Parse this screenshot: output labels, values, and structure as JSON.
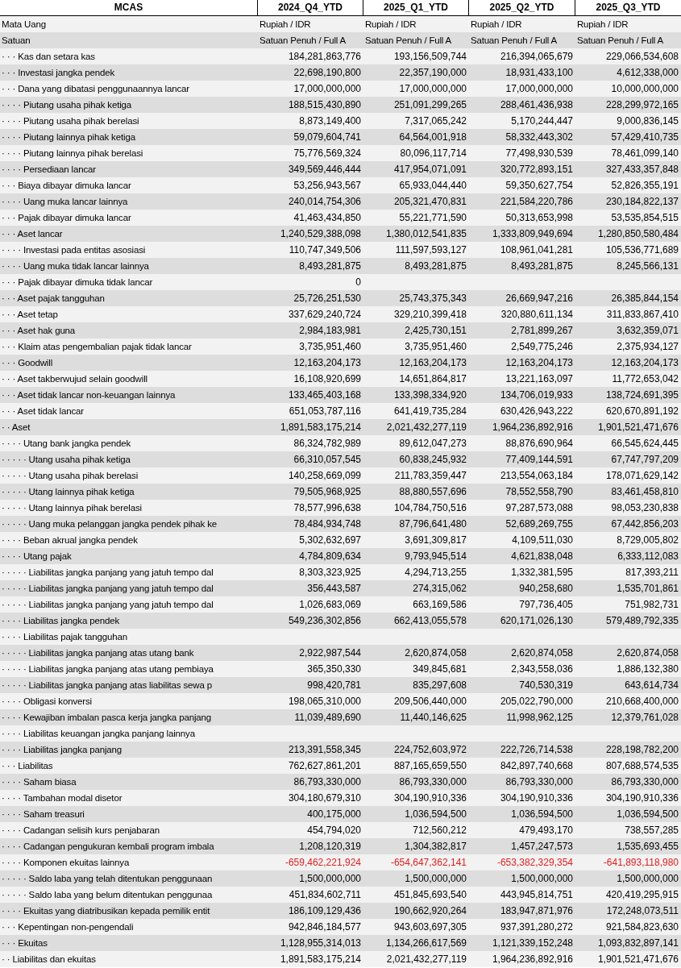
{
  "sheet": {
    "corner": "MCAS",
    "columns": [
      "2024_Q4_YTD",
      "2025_Q1_YTD",
      "2025_Q2_YTD",
      "2025_Q3_YTD"
    ],
    "rows": [
      {
        "label": "Mata Uang",
        "kind": "text",
        "negative": false,
        "values": [
          "Rupiah / IDR",
          "Rupiah / IDR",
          "Rupiah / IDR",
          "Rupiah / IDR"
        ]
      },
      {
        "label": "Satuan",
        "kind": "text",
        "negative": false,
        "values": [
          "Satuan Penuh / Full A",
          "Satuan Penuh / Full A",
          "Satuan Penuh / Full A",
          "Satuan Penuh / Full A"
        ]
      },
      {
        "label": "· · · Kas dan setara kas",
        "kind": "number",
        "negative": false,
        "values": [
          "184,281,863,776",
          "193,156,509,744",
          "216,394,065,679",
          "229,066,534,608"
        ]
      },
      {
        "label": "· · · Investasi jangka pendek",
        "kind": "number",
        "negative": false,
        "values": [
          "22,698,190,800",
          "22,357,190,000",
          "18,931,433,100",
          "4,612,338,000"
        ]
      },
      {
        "label": "· · · Dana yang dibatasi penggunaannya lancar",
        "kind": "number",
        "negative": false,
        "values": [
          "17,000,000,000",
          "17,000,000,000",
          "17,000,000,000",
          "10,000,000,000"
        ]
      },
      {
        "label": "· · · · Piutang usaha pihak ketiga",
        "kind": "number",
        "negative": false,
        "values": [
          "188,515,430,890",
          "251,091,299,265",
          "288,461,436,938",
          "228,299,972,165"
        ]
      },
      {
        "label": "· · · · Piutang usaha pihak berelasi",
        "kind": "number",
        "negative": false,
        "values": [
          "8,873,149,400",
          "7,317,065,242",
          "5,170,244,447",
          "9,000,836,145"
        ]
      },
      {
        "label": "· · · · Piutang lainnya pihak ketiga",
        "kind": "number",
        "negative": false,
        "values": [
          "59,079,604,741",
          "64,564,001,918",
          "58,332,443,302",
          "57,429,410,735"
        ]
      },
      {
        "label": "· · · · Piutang lainnya pihak berelasi",
        "kind": "number",
        "negative": false,
        "values": [
          "75,776,569,324",
          "80,096,117,714",
          "77,498,930,539",
          "78,461,099,140"
        ]
      },
      {
        "label": "· · · · Persediaan lancar",
        "kind": "number",
        "negative": false,
        "values": [
          "349,569,446,444",
          "417,954,071,091",
          "320,772,893,151",
          "327,433,357,848"
        ]
      },
      {
        "label": "· · · Biaya dibayar dimuka lancar",
        "kind": "number",
        "negative": false,
        "values": [
          "53,256,943,567",
          "65,933,044,440",
          "59,350,627,754",
          "52,826,355,191"
        ]
      },
      {
        "label": "· · · · Uang muka lancar lainnya",
        "kind": "number",
        "negative": false,
        "values": [
          "240,014,754,306",
          "205,321,470,831",
          "221,584,220,786",
          "230,184,822,137"
        ]
      },
      {
        "label": "· · · Pajak dibayar dimuka lancar",
        "kind": "number",
        "negative": false,
        "values": [
          "41,463,434,850",
          "55,221,771,590",
          "50,313,653,998",
          "53,535,854,515"
        ]
      },
      {
        "label": "· · · Aset lancar",
        "kind": "number",
        "negative": false,
        "values": [
          "1,240,529,388,098",
          "1,380,012,541,835",
          "1,333,809,949,694",
          "1,280,850,580,484"
        ]
      },
      {
        "label": "· · · · Investasi pada entitas asosiasi",
        "kind": "number",
        "negative": false,
        "values": [
          "110,747,349,506",
          "111,597,593,127",
          "108,961,041,281",
          "105,536,771,689"
        ]
      },
      {
        "label": "· · · · Uang muka tidak lancar lainnya",
        "kind": "number",
        "negative": false,
        "values": [
          "8,493,281,875",
          "8,493,281,875",
          "8,493,281,875",
          "8,245,566,131"
        ]
      },
      {
        "label": "· · · Pajak dibayar dimuka tidak lancar",
        "kind": "number",
        "negative": false,
        "values": [
          "0"
        ]
      },
      {
        "label": "· · · Aset pajak tangguhan",
        "kind": "number",
        "negative": false,
        "values": [
          "25,726,251,530",
          "25,743,375,343",
          "26,669,947,216",
          "26,385,844,154"
        ]
      },
      {
        "label": "· · · Aset tetap",
        "kind": "number",
        "negative": false,
        "values": [
          "337,629,240,724",
          "329,210,399,418",
          "320,880,611,134",
          "311,833,867,410"
        ]
      },
      {
        "label": "· · · Aset hak guna",
        "kind": "number",
        "negative": false,
        "values": [
          "2,984,183,981",
          "2,425,730,151",
          "2,781,899,267",
          "3,632,359,071"
        ]
      },
      {
        "label": "· · · Klaim atas pengembalian pajak tidak lancar",
        "kind": "number",
        "negative": false,
        "values": [
          "3,735,951,460",
          "3,735,951,460",
          "2,549,775,246",
          "2,375,934,127"
        ]
      },
      {
        "label": "· · · Goodwill",
        "kind": "number",
        "negative": false,
        "values": [
          "12,163,204,173",
          "12,163,204,173",
          "12,163,204,173",
          "12,163,204,173"
        ]
      },
      {
        "label": "· · · Aset takberwujud selain goodwill",
        "kind": "number",
        "negative": false,
        "values": [
          "16,108,920,699",
          "14,651,864,817",
          "13,221,163,097",
          "11,772,653,042"
        ]
      },
      {
        "label": "· · · Aset tidak lancar non-keuangan lainnya",
        "kind": "number",
        "negative": false,
        "values": [
          "133,465,403,168",
          "133,398,334,920",
          "134,706,019,933",
          "138,724,691,395"
        ]
      },
      {
        "label": "· · · Aset tidak lancar",
        "kind": "number",
        "negative": false,
        "values": [
          "651,053,787,116",
          "641,419,735,284",
          "630,426,943,222",
          "620,670,891,192"
        ]
      },
      {
        "label": "· · Aset",
        "kind": "number",
        "negative": false,
        "values": [
          "1,891,583,175,214",
          "2,021,432,277,119",
          "1,964,236,892,916",
          "1,901,521,471,676"
        ]
      },
      {
        "label": "· · · · Utang bank jangka pendek",
        "kind": "number",
        "negative": false,
        "values": [
          "86,324,782,989",
          "89,612,047,273",
          "88,876,690,964",
          "66,545,624,445"
        ]
      },
      {
        "label": "· · · · · Utang usaha pihak ketiga",
        "kind": "number",
        "negative": false,
        "values": [
          "66,310,057,545",
          "60,838,245,932",
          "77,409,144,591",
          "67,747,797,209"
        ]
      },
      {
        "label": "· · · · · Utang usaha pihak berelasi",
        "kind": "number",
        "negative": false,
        "values": [
          "140,258,669,099",
          "211,783,359,447",
          "213,554,063,184",
          "178,071,629,142"
        ]
      },
      {
        "label": "· · · · · Utang lainnya pihak ketiga",
        "kind": "number",
        "negative": false,
        "values": [
          "79,505,968,925",
          "88,880,557,696",
          "78,552,558,790",
          "83,461,458,810"
        ]
      },
      {
        "label": "· · · · · Utang lainnya pihak berelasi",
        "kind": "number",
        "negative": false,
        "values": [
          "78,577,996,638",
          "104,784,750,516",
          "97,287,573,088",
          "98,053,230,838"
        ]
      },
      {
        "label": "· · · · · Uang muka pelanggan jangka pendek pihak ke",
        "kind": "number",
        "negative": false,
        "values": [
          "78,484,934,748",
          "87,796,641,480",
          "52,689,269,755",
          "67,442,856,203"
        ]
      },
      {
        "label": "· · · · Beban akrual jangka pendek",
        "kind": "number",
        "negative": false,
        "values": [
          "5,302,632,697",
          "3,691,309,817",
          "4,109,511,030",
          "8,729,005,802"
        ]
      },
      {
        "label": "· · · · Utang pajak",
        "kind": "number",
        "negative": false,
        "values": [
          "4,784,809,634",
          "9,793,945,514",
          "4,621,838,048",
          "6,333,112,083"
        ]
      },
      {
        "label": "· · · · · Liabilitas jangka panjang yang jatuh tempo dal",
        "kind": "number",
        "negative": false,
        "values": [
          "8,303,323,925",
          "4,294,713,255",
          "1,332,381,595",
          "817,393,211"
        ]
      },
      {
        "label": "· · · · · Liabilitas jangka panjang yang jatuh tempo dal",
        "kind": "number",
        "negative": false,
        "values": [
          "356,443,587",
          "274,315,062",
          "940,258,680",
          "1,535,701,861"
        ]
      },
      {
        "label": "· · · · · Liabilitas jangka panjang yang jatuh tempo dal",
        "kind": "number",
        "negative": false,
        "values": [
          "1,026,683,069",
          "663,169,586",
          "797,736,405",
          "751,982,731"
        ]
      },
      {
        "label": "· · · · Liabilitas jangka pendek",
        "kind": "number",
        "negative": false,
        "values": [
          "549,236,302,856",
          "662,413,055,578",
          "620,171,026,130",
          "579,489,792,335"
        ]
      },
      {
        "label": "· · · · Liabilitas pajak tangguhan",
        "kind": "number"
      },
      {
        "label": "· · · · · Liabilitas jangka panjang atas utang bank",
        "kind": "number",
        "negative": false,
        "values": [
          "2,922,987,544",
          "2,620,874,058",
          "2,620,874,058",
          "2,620,874,058"
        ]
      },
      {
        "label": "· · · · · Liabilitas jangka panjang atas utang pembiaya",
        "kind": "number",
        "negative": false,
        "values": [
          "365,350,330",
          "349,845,681",
          "2,343,558,036",
          "1,886,132,380"
        ]
      },
      {
        "label": "· · · · · Liabilitas jangka panjang atas liabilitas sewa p",
        "kind": "number",
        "negative": false,
        "values": [
          "998,420,781",
          "835,297,608",
          "740,530,319",
          "643,614,734"
        ]
      },
      {
        "label": "· · · · Obligasi konversi",
        "kind": "number",
        "negative": false,
        "values": [
          "198,065,310,000",
          "209,506,440,000",
          "205,022,790,000",
          "210,668,400,000"
        ]
      },
      {
        "label": "· · · · Kewajiban imbalan pasca kerja jangka panjang",
        "kind": "number",
        "negative": false,
        "values": [
          "11,039,489,690",
          "11,440,146,625",
          "11,998,962,125",
          "12,379,761,028"
        ]
      },
      {
        "label": "· · · · Liabilitas keuangan jangka panjang lainnya",
        "kind": "number"
      },
      {
        "label": "· · · · Liabilitas jangka panjang",
        "kind": "number",
        "negative": false,
        "values": [
          "213,391,558,345",
          "224,752,603,972",
          "222,726,714,538",
          "228,198,782,200"
        ]
      },
      {
        "label": "· · · Liabilitas",
        "kind": "number",
        "negative": false,
        "values": [
          "762,627,861,201",
          "887,165,659,550",
          "842,897,740,668",
          "807,688,574,535"
        ]
      },
      {
        "label": "· · · · Saham biasa",
        "kind": "number",
        "negative": false,
        "values": [
          "86,793,330,000",
          "86,793,330,000",
          "86,793,330,000",
          "86,793,330,000"
        ]
      },
      {
        "label": "· · · · Tambahan modal disetor",
        "kind": "number",
        "negative": false,
        "values": [
          "304,180,679,310",
          "304,190,910,336",
          "304,190,910,336",
          "304,190,910,336"
        ]
      },
      {
        "label": "· · · · Saham treasuri",
        "kind": "number",
        "negative": false,
        "values": [
          "400,175,000",
          "1,036,594,500",
          "1,036,594,500",
          "1,036,594,500"
        ]
      },
      {
        "label": "· · · · Cadangan selisih kurs penjabaran",
        "kind": "number",
        "negative": false,
        "values": [
          "454,794,020",
          "712,560,212",
          "479,493,170",
          "738,557,285"
        ]
      },
      {
        "label": "· · · · Cadangan pengukuran kembali program imbala",
        "kind": "number",
        "negative": false,
        "values": [
          "1,208,120,319",
          "1,304,382,817",
          "1,457,247,573",
          "1,535,693,455"
        ]
      },
      {
        "label": "· · · · Komponen ekuitas lainnya",
        "kind": "number",
        "negative": true,
        "values": [
          "-659,462,221,924",
          "-654,647,362,141",
          "-653,382,329,354",
          "-641,893,118,980"
        ]
      },
      {
        "label": "· · · · · Saldo laba yang telah ditentukan penggunaan",
        "kind": "number",
        "negative": false,
        "values": [
          "1,500,000,000",
          "1,500,000,000",
          "1,500,000,000",
          "1,500,000,000"
        ]
      },
      {
        "label": "· · · · · Saldo laba yang belum ditentukan penggunaa",
        "kind": "number",
        "negative": false,
        "values": [
          "451,834,602,711",
          "451,845,693,540",
          "443,945,814,751",
          "420,419,295,915"
        ]
      },
      {
        "label": "· · · · Ekuitas yang diatribusikan kepada pemilik entit",
        "kind": "number",
        "negative": false,
        "values": [
          "186,109,129,436",
          "190,662,920,264",
          "183,947,871,976",
          "172,248,073,511"
        ]
      },
      {
        "label": "· · · Kepentingan non-pengendali",
        "kind": "number",
        "negative": false,
        "values": [
          "942,846,184,577",
          "943,603,697,305",
          "937,391,280,272",
          "921,584,823,630"
        ]
      },
      {
        "label": "· · · Ekuitas",
        "kind": "number",
        "negative": false,
        "values": [
          "1,128,955,314,013",
          "1,134,266,617,569",
          "1,121,339,152,248",
          "1,093,832,897,141"
        ]
      },
      {
        "label": "· · Liabilitas dan ekuitas",
        "kind": "number",
        "negative": false,
        "values": [
          "1,891,583,175,214",
          "2,021,432,277,119",
          "1,964,236,892,916",
          "1,901,521,471,676"
        ]
      }
    ]
  }
}
